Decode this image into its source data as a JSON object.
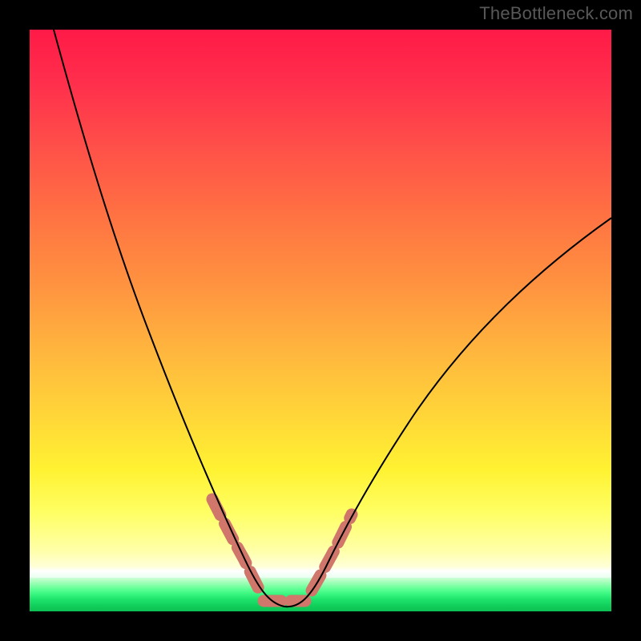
{
  "watermark": "TheBottleneck.com",
  "chart_data": {
    "type": "line",
    "title": "",
    "xlabel": "",
    "ylabel": "",
    "xlim": [
      0,
      100
    ],
    "ylim": [
      0,
      100
    ],
    "grid": false,
    "legend": false,
    "note": "Valley-shaped curve over vertical red→yellow→green gradient. Y represents mismatch/bottleneck percentage (high=red/bad, low=green/good). Curve reaches minimum ≈0 around x≈40–47. Pink dashed markers overlay the valley walls and floor. Values estimated from pixel positions.",
    "series": [
      {
        "name": "curve",
        "x": [
          4,
          8,
          12,
          16,
          20,
          24,
          28,
          32,
          35,
          38,
          40,
          42,
          44,
          46,
          48,
          50,
          53,
          57,
          62,
          68,
          75,
          82,
          90,
          100
        ],
        "y": [
          100,
          88,
          76,
          64,
          53,
          42,
          31,
          20,
          12,
          6,
          3,
          1,
          0.5,
          0.5,
          1,
          3,
          6,
          12,
          20,
          30,
          40,
          49,
          58,
          68
        ]
      }
    ],
    "highlight_segments": [
      {
        "name": "left-wall",
        "x_range": [
          31,
          39
        ],
        "y_range": [
          20,
          4
        ]
      },
      {
        "name": "floor",
        "x_range": [
          40,
          47
        ],
        "y_range": [
          1,
          1
        ]
      },
      {
        "name": "right-wall",
        "x_range": [
          48,
          55
        ],
        "y_range": [
          4,
          13
        ]
      }
    ],
    "gradient_scale": {
      "0": "#0cc054",
      "4": "#36f57e",
      "7": "#ffffff",
      "12": "#ffff90",
      "25": "#ffe038",
      "45": "#ffa640",
      "70": "#ff6646",
      "100": "#ff1a47"
    },
    "highlight_style": {
      "stroke": "#d0766a",
      "stroke_width": 15,
      "dash": [
        22,
        12
      ]
    }
  }
}
